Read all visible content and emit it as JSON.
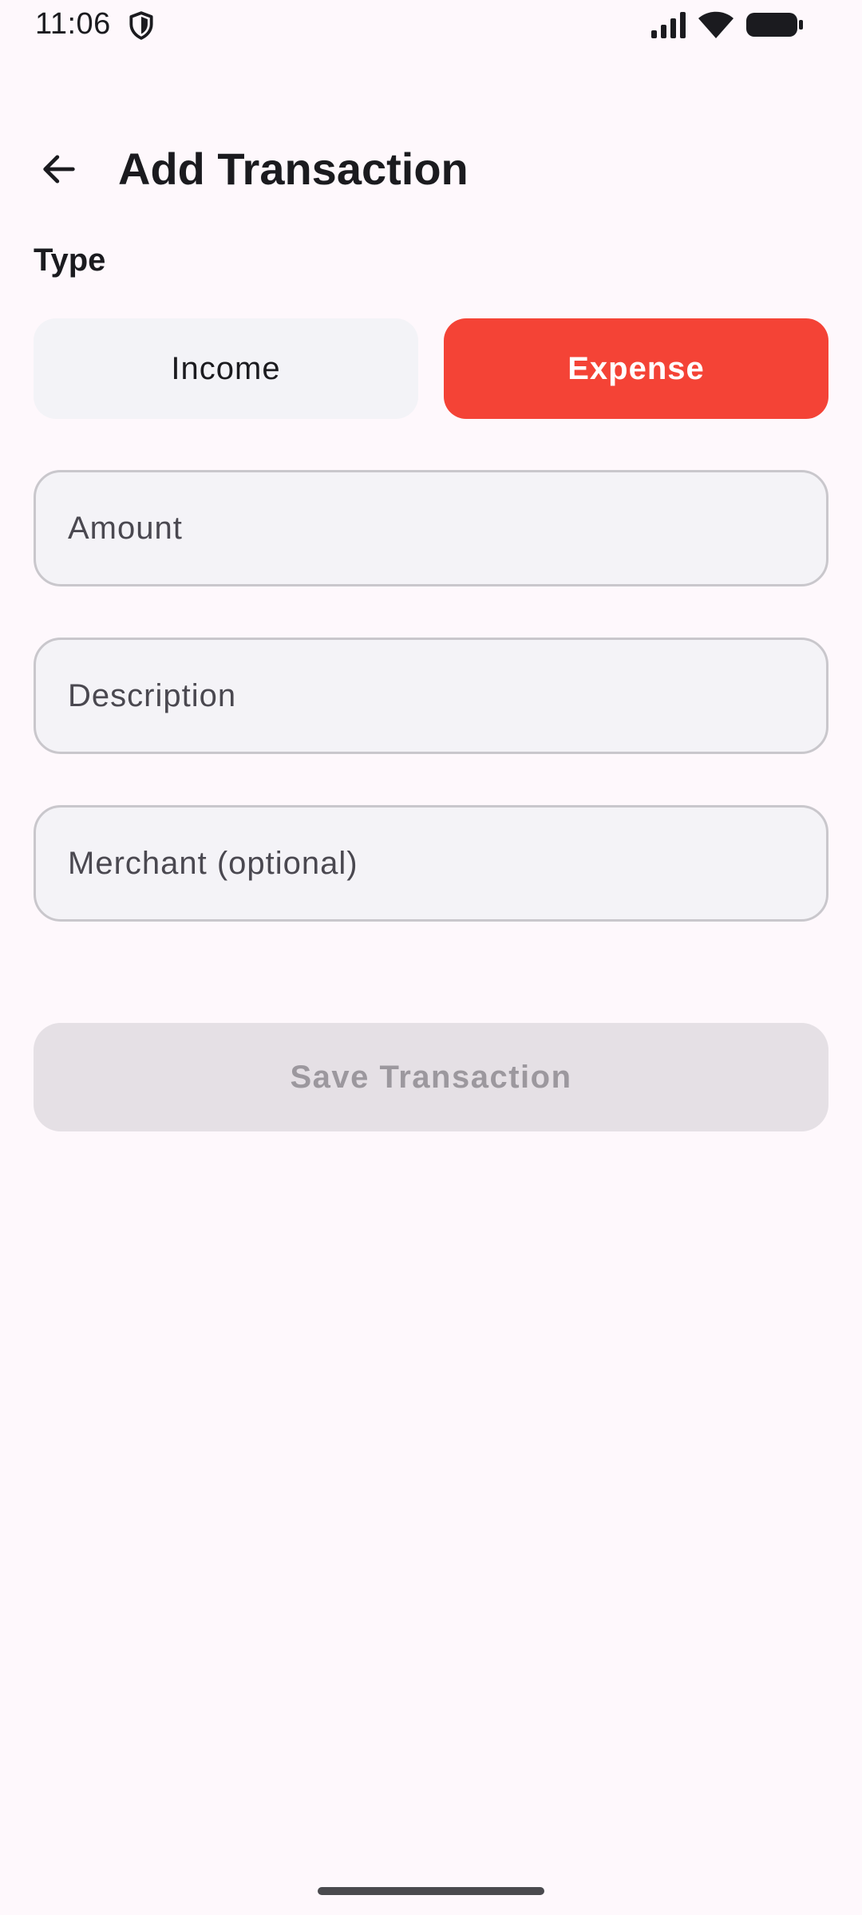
{
  "status_bar": {
    "time": "11:06",
    "icons": [
      "shield-icon",
      "signal-icon",
      "wifi-icon",
      "battery-icon"
    ]
  },
  "top_bar": {
    "back_icon": "arrow-left-icon",
    "title": "Add Transaction"
  },
  "form": {
    "type_label": "Type",
    "type_options": [
      {
        "label": "Income",
        "selected": false
      },
      {
        "label": "Expense",
        "selected": true
      }
    ],
    "amount": {
      "placeholder": "Amount",
      "value": ""
    },
    "description": {
      "placeholder": "Description",
      "value": ""
    },
    "merchant": {
      "placeholder": "Merchant (optional)",
      "value": ""
    },
    "save_label": "Save Transaction"
  },
  "colors": {
    "background": "#FEF8FC",
    "expense_selected": "#F44336",
    "option_unselected": "#F3F3F7",
    "save_disabled_bg": "#E5E0E5",
    "save_disabled_text": "#9C989E"
  }
}
